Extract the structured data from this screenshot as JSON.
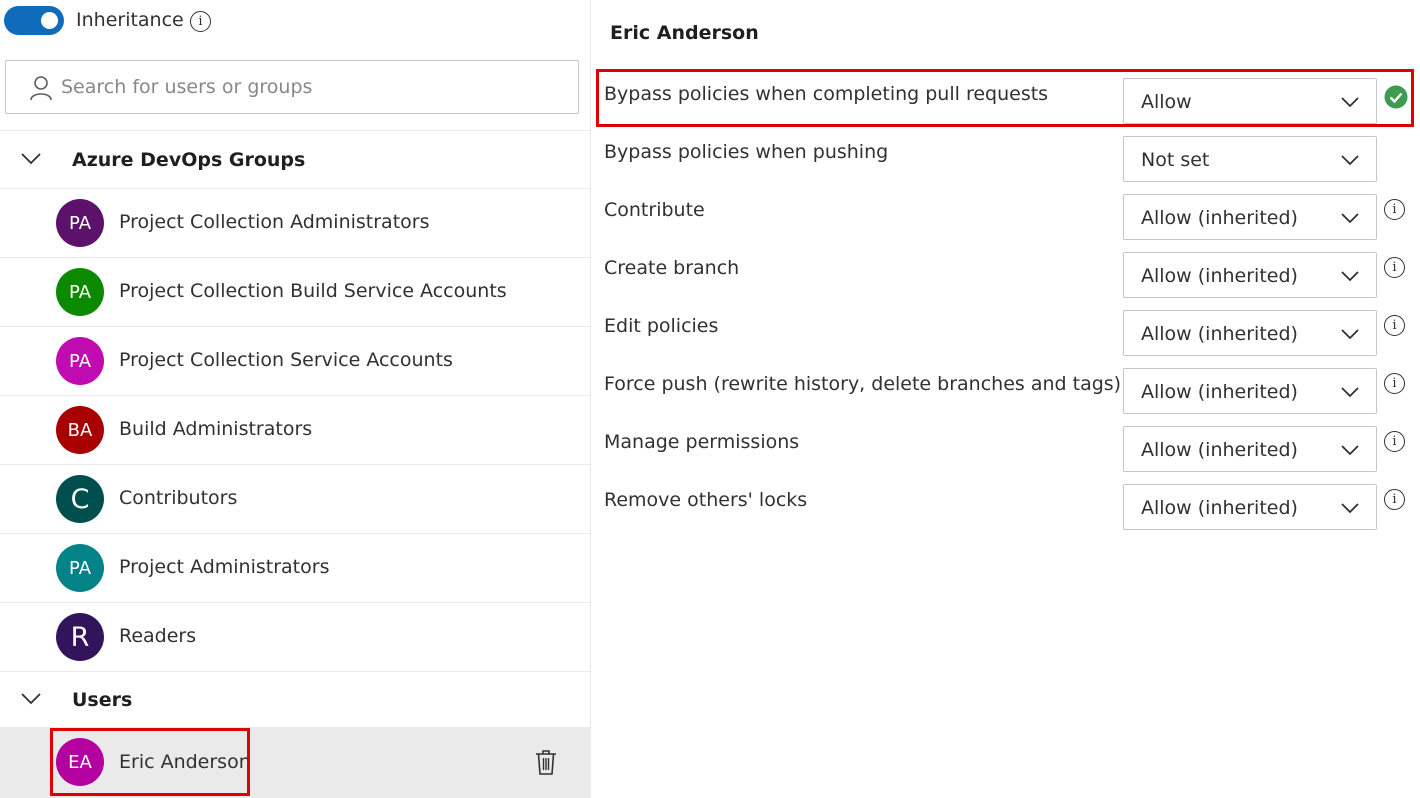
{
  "left": {
    "inheritance": {
      "label": "Inheritance",
      "enabled": true
    },
    "search": {
      "placeholder": "Search for users or groups",
      "value": ""
    },
    "groups_section": {
      "title": "Azure DevOps Groups",
      "items": [
        {
          "initials": "PA",
          "name": "Project Collection Administrators",
          "color": "#5c126b"
        },
        {
          "initials": "PA",
          "name": "Project Collection Build Service Accounts",
          "color": "#0b8a00"
        },
        {
          "initials": "PA",
          "name": "Project Collection Service Accounts",
          "color": "#bf0bb0"
        },
        {
          "initials": "BA",
          "name": "Build Administrators",
          "color": "#a80000"
        },
        {
          "initials": "C",
          "name": "Contributors",
          "color": "#004e4e"
        },
        {
          "initials": "PA",
          "name": "Project Administrators",
          "color": "#038387"
        },
        {
          "initials": "R",
          "name": "Readers",
          "color": "#32145a"
        }
      ]
    },
    "users_section": {
      "title": "Users",
      "items": [
        {
          "initials": "EA",
          "name": "Eric Anderson",
          "color": "#b4009e",
          "selected": true
        }
      ]
    }
  },
  "right": {
    "title": "Eric Anderson",
    "permissions": [
      {
        "label": "Bypass policies when completing pull requests",
        "value": "Allow",
        "indicator": "check-icon",
        "highlighted": true
      },
      {
        "label": "Bypass policies when pushing",
        "value": "Not set",
        "indicator": ""
      },
      {
        "label": "Contribute",
        "value": "Allow (inherited)",
        "indicator": "info-icon"
      },
      {
        "label": "Create branch",
        "value": "Allow (inherited)",
        "indicator": "info-icon"
      },
      {
        "label": "Edit policies",
        "value": "Allow (inherited)",
        "indicator": "info-icon"
      },
      {
        "label": "Force push (rewrite history, delete branches and tags)",
        "value": "Allow (inherited)",
        "indicator": "info-icon"
      },
      {
        "label": "Manage permissions",
        "value": "Allow (inherited)",
        "indicator": "info-icon"
      },
      {
        "label": "Remove others' locks",
        "value": "Allow (inherited)",
        "indicator": "info-icon"
      }
    ]
  },
  "colors": {
    "accent": "#0f6cbd",
    "highlight": "#e00000",
    "success": "#3f9b52"
  },
  "icons": {
    "info": "i"
  }
}
